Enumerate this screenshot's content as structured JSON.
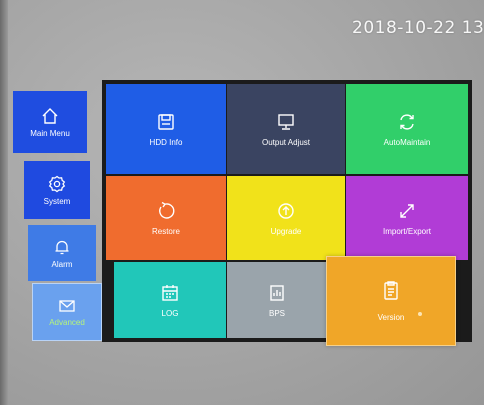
{
  "header": {
    "datetime": "2018-10-22 13"
  },
  "sidebar": {
    "items": [
      {
        "label": "Main Menu",
        "icon": "home-icon",
        "color": "#1f4de0"
      },
      {
        "label": "System",
        "icon": "gear-icon",
        "color": "#1f4ae0"
      },
      {
        "label": "Alarm",
        "icon": "bell-icon",
        "color": "#3f7be6"
      },
      {
        "label": "Advanced",
        "icon": "mail-icon",
        "color": "#6aa1ee"
      }
    ]
  },
  "grid": {
    "tiles": [
      {
        "label": "HDD Info",
        "icon": "disk-icon",
        "color": "#1f5de6"
      },
      {
        "label": "Output Adjust",
        "icon": "monitor-icon",
        "color": "#3a4461"
      },
      {
        "label": "AutoMaintain",
        "icon": "refresh-icon",
        "color": "#31cf6a"
      },
      {
        "label": "Restore",
        "icon": "restore-icon",
        "color": "#f06c2e"
      },
      {
        "label": "Upgrade",
        "icon": "upload-icon",
        "color": "#f1e21a"
      },
      {
        "label": "Import/Export",
        "icon": "arrows-icon",
        "color": "#b13cd6"
      },
      {
        "label": "LOG",
        "icon": "calendar-icon",
        "color": "#21c7b9"
      },
      {
        "label": "BPS",
        "icon": "bps-icon",
        "color": "#9aa4ab"
      },
      {
        "label": "Version",
        "icon": "document-icon",
        "color": "#f0a628"
      }
    ]
  }
}
